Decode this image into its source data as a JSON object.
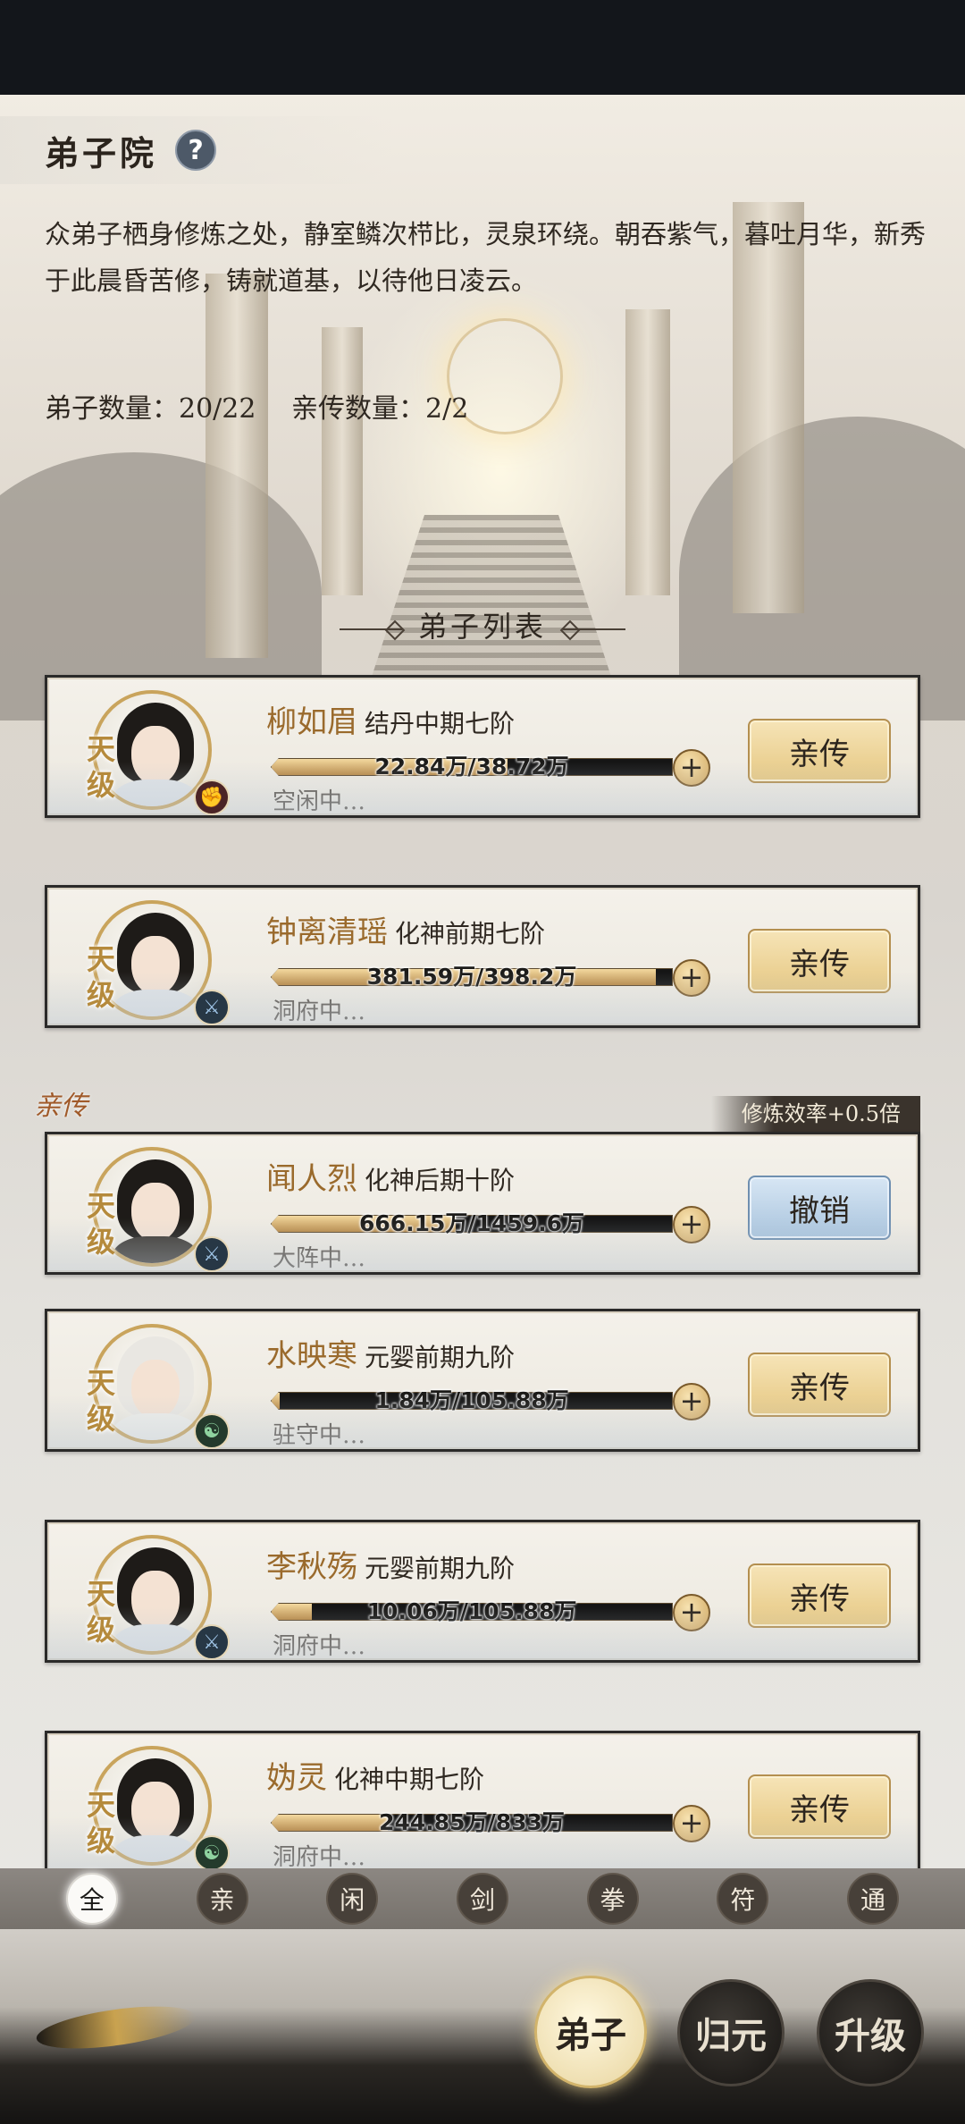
{
  "header": {
    "title": "弟子院",
    "help_icon": "?",
    "description": "众弟子栖身修炼之处，静室鳞次栉比，灵泉环绕。朝吞紫气，暮吐月华，新秀于此晨昏苦修，铸就道基，以待他日凌云。",
    "disciple_count": "弟子数量：20/22",
    "personal_count": "亲传数量：2/2",
    "list_title": "弟子列表"
  },
  "disciples": [
    {
      "tier": "天级",
      "name": "柳如眉",
      "realm": "结丹中期七阶",
      "exp": "22.84万/38.72万",
      "progress": 0.59,
      "status": "空闲中…",
      "action": "亲传",
      "element_icon": "fist-icon"
    },
    {
      "tier": "天级",
      "name": "钟离清瑶",
      "realm": "化神前期七阶",
      "exp": "381.59万/398.2万",
      "progress": 0.96,
      "status": "洞府中…",
      "action": "亲传",
      "element_icon": "sword-icon"
    },
    {
      "tier": "天级",
      "name": "闻人烈",
      "realm": "化神后期十阶",
      "exp": "666.15万/1459.6万",
      "progress": 0.46,
      "status": "大阵中…",
      "action": "撤销",
      "element_icon": "sword-icon"
    },
    {
      "tier": "天级",
      "name": "水映寒",
      "realm": "元婴前期九阶",
      "exp": "1.84万/105.88万",
      "progress": 0.02,
      "status": "驻守中…",
      "action": "亲传",
      "element_icon": "talisman-icon"
    },
    {
      "tier": "天级",
      "name": "李秋殇",
      "realm": "元婴前期九阶",
      "exp": "10.06万/105.88万",
      "progress": 0.1,
      "status": "洞府中…",
      "action": "亲传",
      "element_icon": "sword-icon"
    },
    {
      "tier": "天级",
      "name": "妫灵",
      "realm": "化神中期七阶",
      "exp": "244.85万/833万",
      "progress": 0.29,
      "status": "洞府中…",
      "action": "亲传",
      "element_icon": "talisman-icon"
    }
  ],
  "personal_tag": "亲传",
  "bonus_tag": "修炼效率+0.5倍",
  "filters": [
    "全",
    "亲",
    "闲",
    "剑",
    "拳",
    "符",
    "通"
  ],
  "nav": {
    "disciples": "弟子",
    "return": "归元",
    "upgrade": "升级"
  }
}
